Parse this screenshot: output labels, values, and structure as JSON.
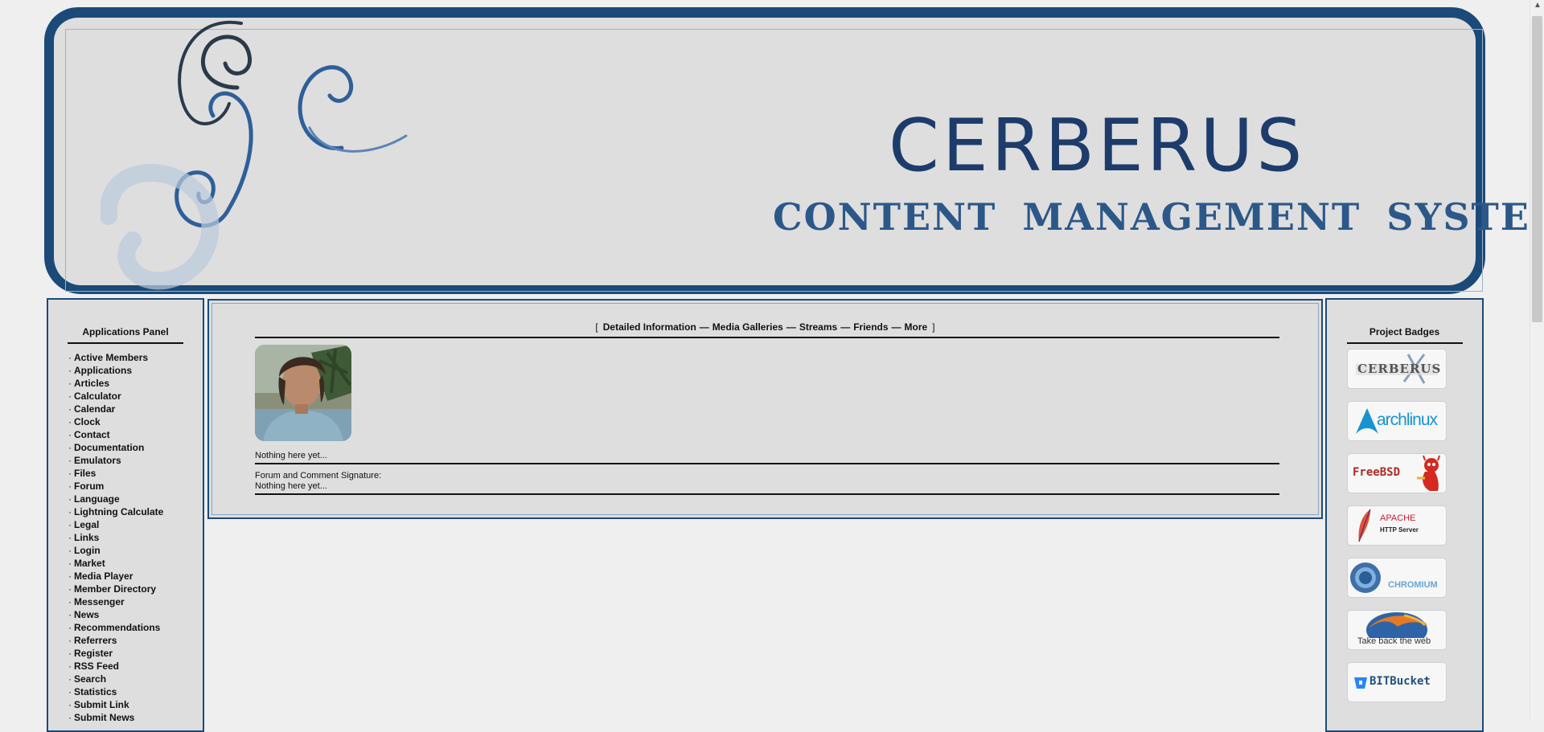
{
  "banner": {
    "title": "CERBERUS",
    "subtitle": "CONTENT MANAGEMENT SYSTEM"
  },
  "left_panel": {
    "title": "Applications Panel",
    "bullet": "·",
    "items": [
      "Active Members",
      "Applications",
      "Articles",
      "Calculator",
      "Calendar",
      "Clock",
      "Contact",
      "Documentation",
      "Emulators",
      "Files",
      "Forum",
      "Language",
      "Lightning Calculate",
      "Legal",
      "Links",
      "Login",
      "Market",
      "Media Player",
      "Member Directory",
      "Messenger",
      "News",
      "Recommendations",
      "Referrers",
      "Register",
      "RSS Feed",
      "Search",
      "Statistics",
      "Submit Link",
      "Submit News"
    ]
  },
  "profile": {
    "nav_open": "[",
    "nav_close": "]",
    "nav_sep": "—",
    "nav_links": [
      "Detailed Information",
      "Media Galleries",
      "Streams",
      "Friends",
      "More"
    ],
    "about_text": "Nothing here yet...",
    "signature_label": "Forum and Comment Signature:",
    "signature_text": "Nothing here yet..."
  },
  "right_panel": {
    "title": "Project Badges",
    "badges": [
      {
        "name": "cerberus",
        "text": "CERBERUS",
        "color": "#555555"
      },
      {
        "name": "archlinux",
        "text": "archlinux",
        "color": "#1793d1"
      },
      {
        "name": "freebsd",
        "text": "FreeBSD",
        "color": "#ab2b28"
      },
      {
        "name": "apache",
        "text": "APACHE",
        "sub": "HTTP Server",
        "color": "#c92037"
      },
      {
        "name": "chromium",
        "text": "CHROMIUM",
        "color": "#6aa5d6"
      },
      {
        "name": "firefox",
        "text": "Take back the web",
        "color": "#333333"
      },
      {
        "name": "bitbucket",
        "text": "BITBucket",
        "color": "#205081"
      }
    ]
  }
}
